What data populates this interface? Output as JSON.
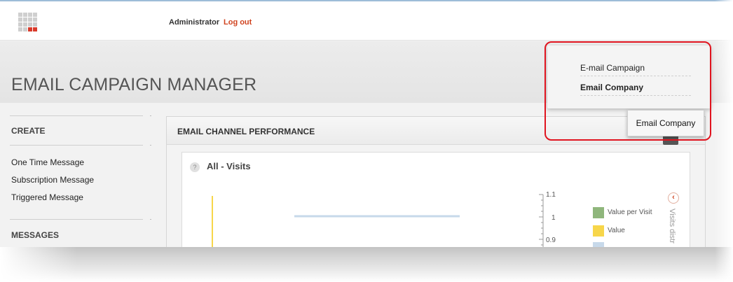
{
  "topbar": {
    "user": "Administrator",
    "logout_label": "Log out"
  },
  "header": {
    "title": "EMAIL CAMPAIGN MANAGER"
  },
  "sidebar": {
    "create_heading": "CREATE",
    "create_items": [
      "One Time Message",
      "Subscription Message",
      "Triggered Message"
    ],
    "messages_heading": "MESSAGES"
  },
  "panel": {
    "title": "EMAIL CHANNEL PERFORMANCE",
    "card_title": "All - Visits",
    "help_glyph": "?",
    "axis_ticks": [
      "1.1",
      "1",
      "0.9"
    ],
    "legend": [
      {
        "label": "Value per Visit",
        "color": "#8fb67c"
      },
      {
        "label": "Value",
        "color": "#f7d64a"
      }
    ],
    "side_label": "Visits distr",
    "nav_arrow": "‹"
  },
  "dropdown": {
    "items": [
      "E-mail Campaign",
      "Email Company"
    ],
    "selected": "Email Company",
    "button_label": "Email Company"
  },
  "colors": {
    "accent": "#d0431f",
    "highlight": "#e0141f",
    "line_blue": "#c7d9ea",
    "bar_yellow": "#f7d64a"
  },
  "icons": {
    "logo": "grid-logo-icon",
    "help": "question-circle-icon",
    "nav": "chevron-left-icon"
  }
}
